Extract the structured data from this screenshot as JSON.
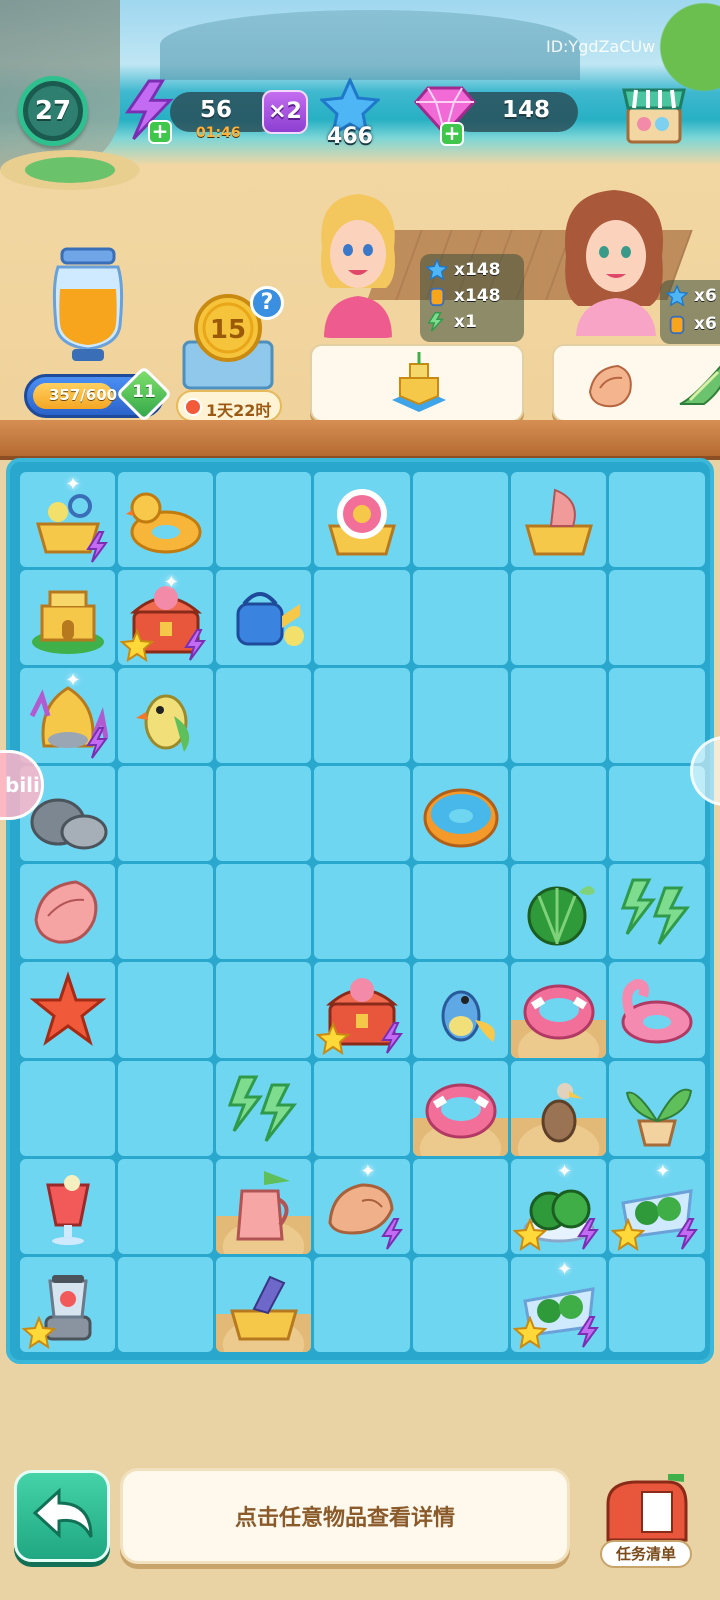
{
  "account": {
    "id_text": "ID:YgdZaCUw"
  },
  "hud": {
    "level": "27",
    "energy": "56",
    "energy_timer": "01:46",
    "multiplier": "×2",
    "stars": "466",
    "gems": "148",
    "icons": {
      "energy": "lightning-bolt-icon",
      "star": "blue-star-icon",
      "gem": "pink-gem-icon",
      "shop": "shop-stall-icon"
    }
  },
  "jar": {
    "progress_text": "357/600",
    "progress_fraction": 0.595,
    "level_badge": "11"
  },
  "coin_event": {
    "coin_value": "15",
    "help_mark": "?",
    "timer": "1天22时"
  },
  "orders": [
    {
      "character": "blonde-woman",
      "rewards": [
        {
          "icon": "star-icon",
          "amount": "x148"
        },
        {
          "icon": "juice-icon",
          "amount": "x148"
        },
        {
          "icon": "bolt-pack-icon",
          "amount": "x1"
        }
      ],
      "requested_items": [
        "sandcastle"
      ]
    },
    {
      "character": "brunette-woman",
      "rewards": [
        {
          "icon": "star-icon",
          "amount": "x6"
        },
        {
          "icon": "juice-icon",
          "amount": "x6"
        }
      ],
      "requested_items": [
        "conch-shell",
        "spiral-shell"
      ]
    }
  ],
  "board": {
    "rows": 9,
    "cols": 7,
    "cells": [
      [
        "toy-basket",
        "duck-float",
        "",
        "swim-ring-basket",
        "",
        "fish-basket",
        ""
      ],
      [
        "sandcastle",
        "treasure-chest",
        "watering-can",
        "",
        "",
        "",
        ""
      ],
      [
        "seashell-coral",
        "parrot",
        "",
        "",
        "",
        "",
        ""
      ],
      [
        "rocks",
        "",
        "",
        "",
        "donut-float",
        "",
        ""
      ],
      [
        "conch-shell",
        "",
        "",
        "",
        "",
        "watermelon",
        "energy-bolts"
      ],
      [
        "starfish",
        "",
        "",
        "treasure-chest",
        "parrot-blue",
        "swim-ring",
        "flamingo-float"
      ],
      [
        "",
        "",
        "energy-bolts",
        "",
        "swim-ring",
        "pelican",
        "potted-plant"
      ],
      [
        "smoothie",
        "",
        "juice-pitcher",
        "spiral-shell",
        "",
        "watermelon-plate",
        "watermelon-tray"
      ],
      [
        "blender",
        "",
        "ticket-basket",
        "",
        "",
        "watermelon-tray",
        ""
      ]
    ]
  },
  "bottom": {
    "hint": "点击任意物品查看详情",
    "task_list": "任务清单"
  }
}
